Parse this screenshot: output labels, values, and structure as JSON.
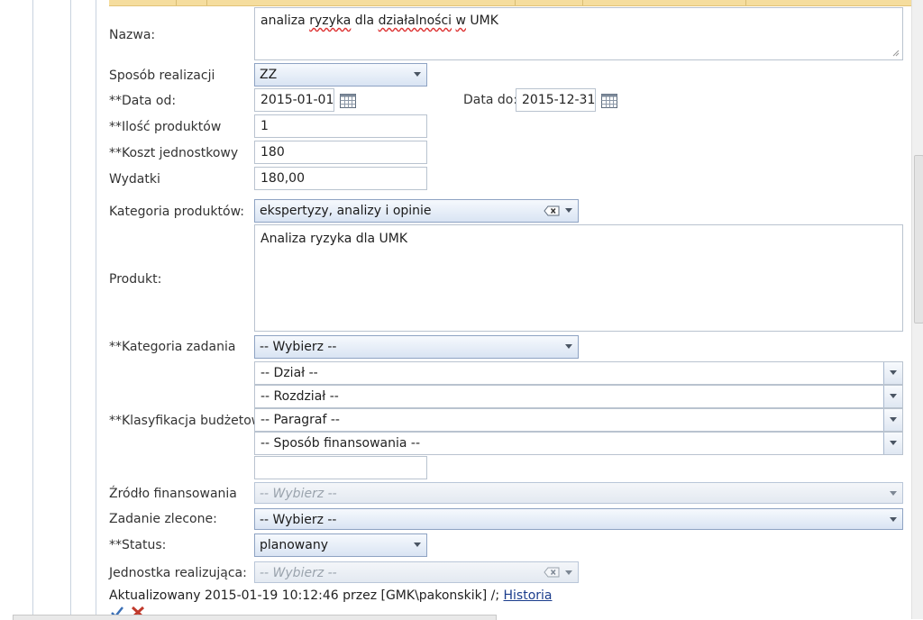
{
  "form": {
    "nazwa": {
      "label": "Nazwa:",
      "value_word1": "analiza",
      "value_mid": " ",
      "value_word2": "ryzyka",
      "value_rest1": " dla ",
      "value_word3": "działalności",
      "value_rest2": " ",
      "value_word4": "w",
      "value_rest3": " UMK"
    },
    "sposob_realizacji": {
      "label": "Sposób realizacji",
      "value": "ZZ"
    },
    "data_od": {
      "label": "**Data od:",
      "value": "2015-01-01"
    },
    "data_do": {
      "label": "Data do:",
      "value": "2015-12-31"
    },
    "ilosc_produktow": {
      "label": "**Ilość produktów",
      "value": "1"
    },
    "koszt_jednostkowy": {
      "label": "**Koszt jednostkowy",
      "value": "180"
    },
    "wydatki": {
      "label": "Wydatki",
      "value": "180,00"
    },
    "kategoria_produktow": {
      "label": "Kategoria produktów:",
      "value": "ekspertyzy, analizy i opinie"
    },
    "produkt": {
      "label": "Produkt:",
      "value": "Analiza ryzyka dla UMK"
    },
    "kategoria_zadania": {
      "label": "**Kategoria zadania",
      "value": "-- Wybierz --"
    },
    "klasyfikacja_budzetowa": {
      "label": "**Klasyfikacja budżetowa",
      "dzial": "-- Dział --",
      "rozdzial": "-- Rozdział --",
      "paragraf": "-- Paragraf --",
      "sposob_finansowania": "-- Sposób finansowania --",
      "extra_value": ""
    },
    "zrodlo_finansowania": {
      "label": "Źródło finansowania",
      "value": "-- Wybierz --"
    },
    "zadanie_zlecone": {
      "label": "Zadanie zlecone:",
      "value": "-- Wybierz --"
    },
    "status": {
      "label": "**Status:",
      "value": "planowany"
    },
    "jednostka_realizujaca": {
      "label": "Jednostka realizująca:",
      "value": "-- Wybierz --"
    }
  },
  "footer": {
    "updated_text": "Aktualizowany 2015-01-19 10:12:46 przez [GMK\\pakonskik]  /;",
    "history_link": "Historia"
  },
  "colors": {
    "combo_border": "#8ea3c3",
    "link": "#1a3c8c",
    "header_strip": "#f5dd9e",
    "save_check": "#3a6fb5",
    "cancel_x": "#c0392b"
  },
  "icons": [
    "calendar-icon",
    "clear-icon",
    "chevron-down-icon",
    "save-check-icon",
    "cancel-x-icon",
    "resize-grip-icon"
  ]
}
